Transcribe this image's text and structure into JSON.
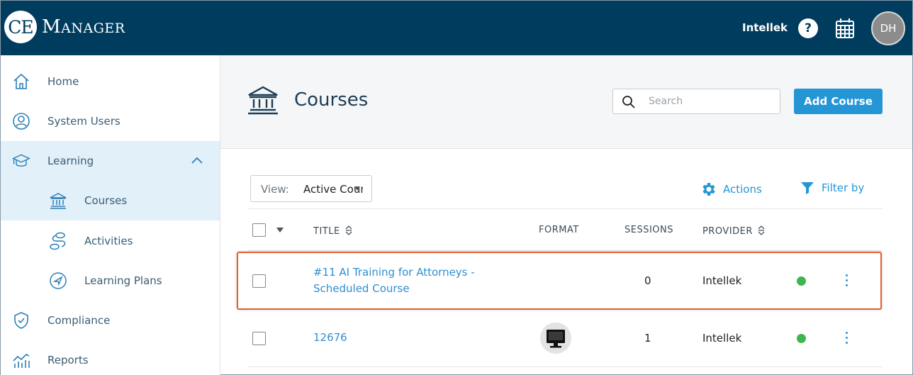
{
  "brand": {
    "logo_mark": "CE",
    "logo_text_big1": "M",
    "logo_text_small": "ANAGER"
  },
  "header": {
    "org_name": "Intellek",
    "help_label": "?",
    "avatar_initials": "DH"
  },
  "sidebar": {
    "items": [
      {
        "label": "Home",
        "icon": "home-icon"
      },
      {
        "label": "System Users",
        "icon": "user-circle-icon"
      },
      {
        "label": "Learning",
        "icon": "graduation-cap-icon",
        "expanded": true
      },
      {
        "label": "Courses",
        "icon": "institution-icon",
        "active": true
      },
      {
        "label": "Activities",
        "icon": "activities-icon"
      },
      {
        "label": "Learning Plans",
        "icon": "navigation-icon"
      },
      {
        "label": "Compliance",
        "icon": "shield-check-icon"
      },
      {
        "label": "Reports",
        "icon": "chart-icon"
      }
    ]
  },
  "page": {
    "title": "Courses",
    "search_placeholder": "Search",
    "add_button": "Add Course"
  },
  "toolbar": {
    "view_label": "View:",
    "view_value": "Active Courses",
    "actions_label": "Actions",
    "filter_label": "Filter by"
  },
  "table": {
    "columns": [
      "TITLE",
      "FORMAT",
      "SESSIONS",
      "PROVIDER"
    ],
    "rows": [
      {
        "title_line1": "#11 AI Training for Attorneys  -",
        "title_line2": "Scheduled Course",
        "format": "",
        "sessions": "0",
        "provider": "Intellek",
        "status": "active",
        "highlighted": true
      },
      {
        "title_line1": "12676",
        "title_line2": "",
        "format": "computer-icon",
        "sessions": "1",
        "provider": "Intellek",
        "status": "active",
        "highlighted": false
      }
    ]
  },
  "colors": {
    "topbar": "#003c5e",
    "accent": "#2496d6",
    "active_bg": "#e1f0f9",
    "status_green": "#3fb550",
    "highlight": "#e4622a"
  }
}
